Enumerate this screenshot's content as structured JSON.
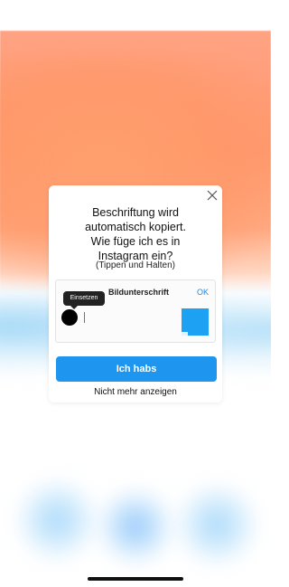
{
  "modal": {
    "title_lines": [
      "Beschriftung wird",
      "automatisch kopiert.",
      "Wie füge ich es in",
      "Instagram ein?"
    ],
    "subtitle": "(Tippen und Halten)",
    "preview": {
      "header": "Bildunterschrift",
      "ok_label": "OK",
      "tooltip": "Einsetzen"
    },
    "primary_button": "Ich habs",
    "secondary_link": "Nicht mehr anzeigen"
  },
  "icons": {
    "close": "close-icon"
  },
  "colors": {
    "primary_blue": "#1e95ee",
    "link_blue": "#1a8ae8",
    "thumbnail_blue": "#1da1f2",
    "background_orange": "#ff9a72",
    "tooltip_dark": "#222222"
  }
}
